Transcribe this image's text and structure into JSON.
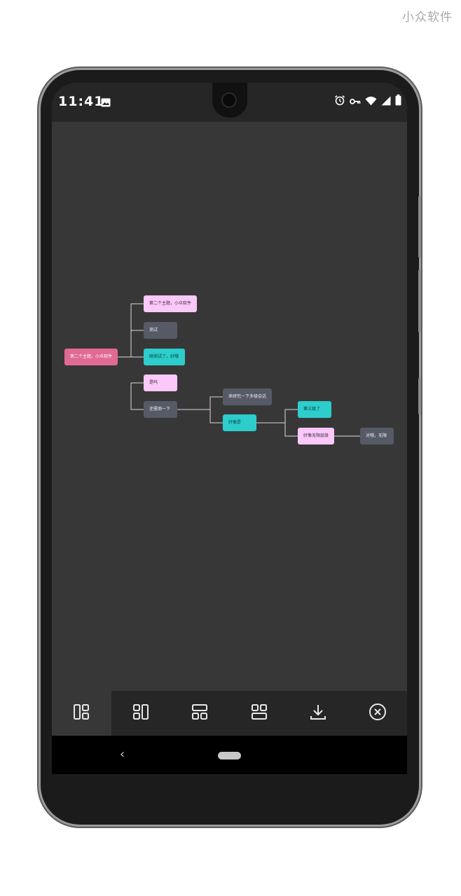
{
  "watermark": "小众软件",
  "status_bar": {
    "time": "11:41",
    "left_icons": [
      "image-icon"
    ],
    "right_icons": [
      "alarm-icon",
      "vpn-key-icon",
      "wifi-icon",
      "signal-icon",
      "battery-icon"
    ]
  },
  "mindmap": {
    "root": "第二个主题，小众软件",
    "level1": [
      "第二个主题，小众软件",
      "测试",
      "刚测试了，好哦",
      "是吗",
      "还需测一下"
    ],
    "level2": [
      "来研究一下多级会话",
      "好像是"
    ],
    "level3": [
      "第三级了",
      "好像无限层级"
    ],
    "level4": [
      "对哦，无限"
    ]
  },
  "toolbar": {
    "items": [
      "layout-left-icon",
      "layout-right-icon",
      "layout-down-icon",
      "layout-up-icon",
      "download-icon",
      "close-circle-icon"
    ],
    "active_index": 0
  },
  "nav_bar": {
    "back_symbol": "‹"
  },
  "colors": {
    "root_node": "#e06a93",
    "pink_node": "#fbc8fa",
    "gray_node": "#555a66",
    "teal_node": "#2ccdcb",
    "canvas_bg": "#383738"
  }
}
